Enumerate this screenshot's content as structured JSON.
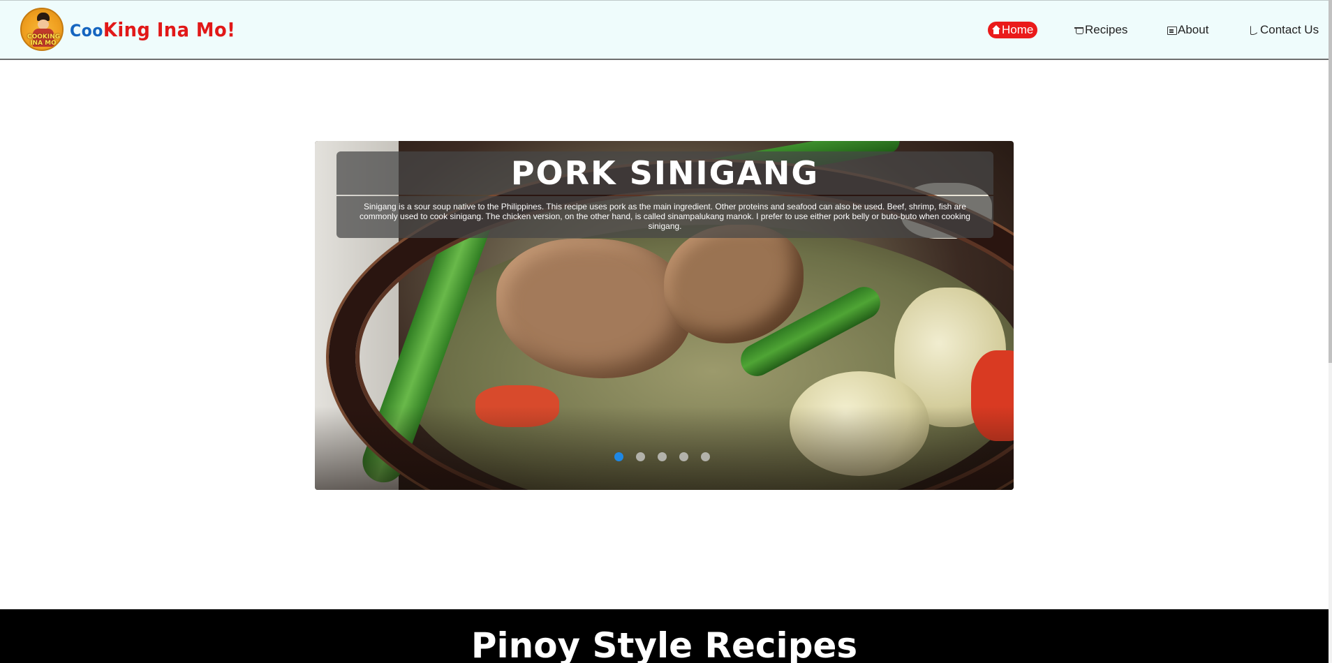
{
  "header": {
    "logo_text": "COOKING INA MO",
    "brand_part1": "Coo",
    "brand_part2": "King Ina Mo!",
    "nav": [
      {
        "label": "Home",
        "icon": "home-icon",
        "active": true
      },
      {
        "label": "Recipes",
        "icon": "pot-icon",
        "active": false
      },
      {
        "label": "About",
        "icon": "newspaper-icon",
        "active": false
      },
      {
        "label": "Contact Us",
        "icon": "phone-icon",
        "active": false
      }
    ]
  },
  "carousel": {
    "title": "PORK SINIGANG",
    "description": "Sinigang is a sour soup native to the Philippines. This recipe uses pork as the main ingredient. Other proteins and seafood can also be used. Beef, shrimp, fish are commonly used to cook sinigang. The chicken version, on the other hand, is called sinampalukang manok. I prefer to use either pork belly or buto-buto when cooking sinigang.",
    "slide_count": 5,
    "active_slide": 1
  },
  "section": {
    "title": "Pinoy Style Recipes"
  },
  "colors": {
    "header_bg": "#effcfc",
    "brand_blue": "#1565c0",
    "brand_red": "#e11818",
    "nav_active_bg": "#ea1a1a",
    "dot_active": "#1e88e5",
    "band_bg": "#000000"
  }
}
